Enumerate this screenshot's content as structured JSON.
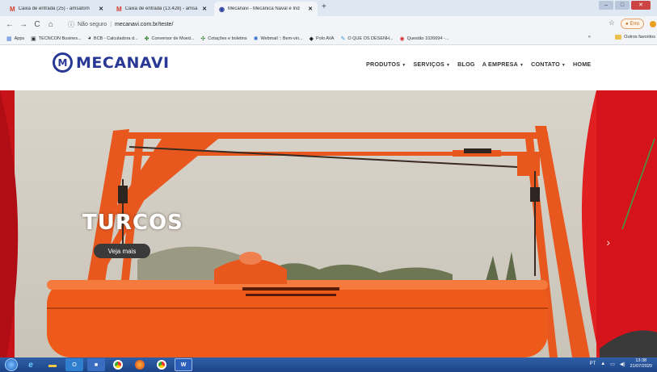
{
  "browser": {
    "tabs": [
      {
        "label": "Caixa de entrada (25) - amsatom",
        "icon": "gmail-icon",
        "close": "✕"
      },
      {
        "label": "Caixa de entrada (13.428) - amsa",
        "icon": "gmail-icon",
        "close": "✕"
      },
      {
        "label": "Mecanavi - Mecânica Naval e Ind",
        "icon": "mecanavi-favicon",
        "close": "✕"
      }
    ],
    "new_tab": "+",
    "security_label": "Não seguro",
    "url": "mecanavi.com.br/teste/",
    "error_pill": "Erro",
    "bookmarks": [
      {
        "label": "Apps",
        "icon": "apps-grid-icon"
      },
      {
        "label": "TECNCON Busines...",
        "icon": "tecncon-icon"
      },
      {
        "label": "BCB - Calculadora d...",
        "icon": "bcb-icon"
      },
      {
        "label": "Conversor de Moed...",
        "icon": "currency-icon"
      },
      {
        "label": "Cotações e boletins",
        "icon": "chart-icon"
      },
      {
        "label": "Webmail :: Bem-vin...",
        "icon": "webmail-icon"
      },
      {
        "label": "Polo AVA",
        "icon": "polo-icon"
      },
      {
        "label": "O QUE OS DESENH...",
        "icon": "desenho-icon"
      },
      {
        "label": "Questão 1026694 -...",
        "icon": "questao-icon"
      }
    ],
    "bookmarks_more": "»",
    "other_bookmarks": "Outros favoritos"
  },
  "site": {
    "logo_text": "MECANAVI",
    "logo_mark": "M",
    "nav": [
      {
        "label": "PRODUTOS",
        "dropdown": true
      },
      {
        "label": "SERVIÇOS",
        "dropdown": true
      },
      {
        "label": "BLOG",
        "dropdown": false
      },
      {
        "label": "A EMPRESA",
        "dropdown": true
      },
      {
        "label": "CONTATO",
        "dropdown": true
      },
      {
        "label": "HOME",
        "dropdown": false
      }
    ],
    "hero": {
      "title": "TURCOS",
      "button": "Veja mais",
      "next_arrow": "›"
    }
  },
  "taskbar": {
    "apps": [
      "start-orb",
      "internet-explorer",
      "file-explorer",
      "outlook",
      "app-generic",
      "chrome",
      "firefox",
      "chrome-2",
      "word"
    ],
    "word_label": "W",
    "language": "PT",
    "time": "13:38",
    "date": "21/07/2020"
  },
  "colors": {
    "brand_blue": "#2a3895",
    "gantry_orange": "#e8581e",
    "hero_red": "#d4141a"
  }
}
